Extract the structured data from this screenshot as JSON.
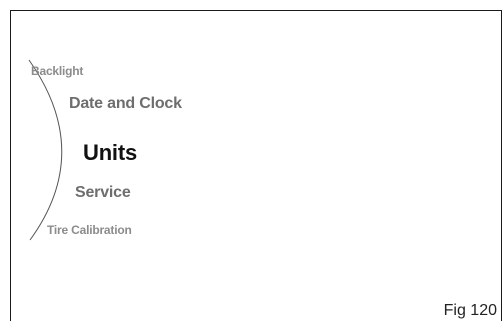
{
  "menu": {
    "items": [
      {
        "label": "Backlight",
        "level": "outer"
      },
      {
        "label": "Date and Clock",
        "level": "mid"
      },
      {
        "label": "Units",
        "level": "selected"
      },
      {
        "label": "Service",
        "level": "mid"
      },
      {
        "label": "Tire Calibration",
        "level": "outer"
      }
    ]
  },
  "figure": {
    "label": "Fig 120"
  },
  "colors": {
    "frame": "#1a1a1a",
    "outer_text": "#8c8c8c",
    "mid_text": "#6e6e6e",
    "selected_text": "#111111",
    "arc": "#555555"
  }
}
